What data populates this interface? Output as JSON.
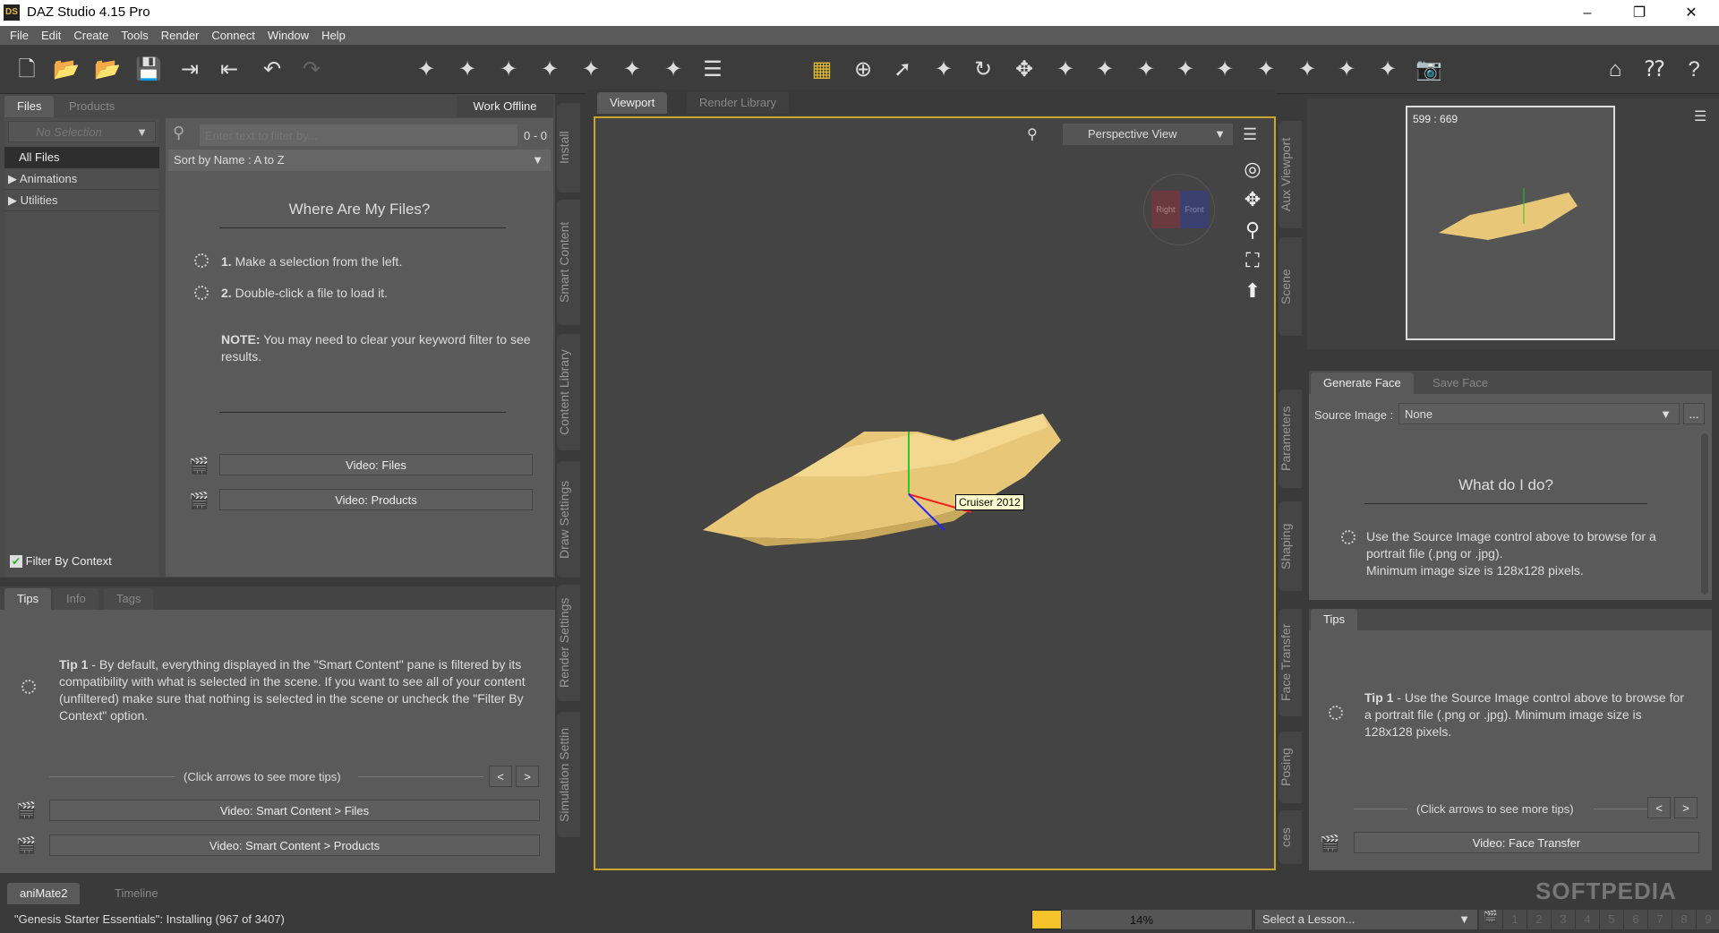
{
  "window": {
    "title": "DAZ Studio 4.15 Pro",
    "logo": "DS",
    "minimize": "–",
    "restore": "❐",
    "close": "✕"
  },
  "menu": [
    "File",
    "Edit",
    "Create",
    "Tools",
    "Render",
    "Connect",
    "Window",
    "Help"
  ],
  "toolbar_icons": [
    "new-file-icon",
    "open-file-icon",
    "merge-file-icon",
    "save-icon",
    "import-icon",
    "export-icon",
    "undo-icon",
    "redo-icon",
    "new-camera-icon",
    "new-spotlight-icon",
    "new-pointlight-icon",
    "new-distant-light-icon",
    "new-linear-light-icon",
    "new-primitive-icon",
    "new-null-icon",
    "align-icon",
    "render-settings-icon",
    "universal-tool-icon",
    "select-icon",
    "active-pose-icon",
    "rotate-icon",
    "translate-icon",
    "scale-icon",
    "joint-editor-icon",
    "morph-icon",
    "surface-selection-icon",
    "figure-setup-icon",
    "camera-cube-icon",
    "render-icon",
    "spot-render-icon",
    "iray-icon",
    "camera-icon",
    "home-icon",
    "whats-this-icon",
    "help-icon"
  ],
  "left": {
    "tabs": [
      "Files",
      "Products"
    ],
    "work_offline": "Work Offline",
    "selection": "No Selection",
    "tree": [
      {
        "label": "All Files",
        "selected": true
      },
      {
        "label": "Animations",
        "expandable": true
      },
      {
        "label": "Utilities",
        "expandable": true
      }
    ],
    "filter_placeholder": "Enter text to filter by...",
    "count": "0 - 0",
    "sort": "Sort by Name : A to Z",
    "help_title": "Where Are My Files?",
    "step1_num": "1.",
    "step1": "Make a selection from the left.",
    "step2_num": "2.",
    "step2": "Double-click a file to load it.",
    "note_label": "NOTE:",
    "note": "You may need to clear your keyword filter to see results.",
    "video_files": "Video: Files",
    "video_products": "Video:  Products",
    "filter_by_context": "Filter By Context",
    "filter_checked": true
  },
  "side_tabs_left": [
    "Install",
    "Smart Content",
    "Content Library",
    "Draw Settings",
    "Render Settings",
    "Simulation Settin"
  ],
  "tips_left": {
    "tabs": [
      "Tips",
      "Info",
      "Tags"
    ],
    "tip_label": "Tip 1",
    "tip": " - By default, everything displayed in the \"Smart Content\" pane is filtered by its compatibility with what is selected in the scene. If you want to see all of your content (unfiltered) make sure that nothing is selected in the scene or uncheck the \"Filter By Context\" option.",
    "more": "(Click arrows to see more tips)",
    "prev": "<",
    "next": ">",
    "video1": "Video: Smart Content > Files",
    "video2": "Video: Smart Content > Products"
  },
  "viewport": {
    "tabs": [
      "Viewport",
      "Render Library"
    ],
    "view": "Perspective View",
    "object_label": "Cruiser 2012",
    "cube_left": "Right",
    "cube_right": "Front",
    "accent": "#e0b830"
  },
  "side_tabs_right": [
    "Aux Viewport",
    "Scene",
    "Parameters",
    "Shaping",
    "Face Transfer",
    "Posing",
    "ces"
  ],
  "aux": {
    "size": "599 : 669"
  },
  "face": {
    "tabs": [
      "Generate Face",
      "Save Face"
    ],
    "source_label": "Source Image :",
    "source_value": "None",
    "browse": "...",
    "title": "What do I do?",
    "text1": "Use the Source Image control above to browse for a portrait file (.png or .jpg).",
    "text2": "Minimum image size is 128x128 pixels."
  },
  "tips_right": {
    "tab": "Tips",
    "tip_label": "Tip 1",
    "tip": " - Use the Source Image control above to browse for a portrait file (.png or .jpg). Minimum image size is 128x128 pixels.",
    "more": "(Click arrows to see more tips)",
    "prev": "<",
    "next": ">",
    "video": "Video: Face Transfer"
  },
  "bottom": {
    "tabs": [
      "aniMate2",
      "Timeline"
    ],
    "status": "\"Genesis Starter Essentials\": Installing (967 of 3407)",
    "progress": 14,
    "progress_label": "14%",
    "lesson": "Select a Lesson...",
    "lesson_pages": [
      "1",
      "2",
      "3",
      "4",
      "5",
      "6",
      "7",
      "8",
      "9"
    ],
    "watermark": "SOFTPEDIA"
  }
}
